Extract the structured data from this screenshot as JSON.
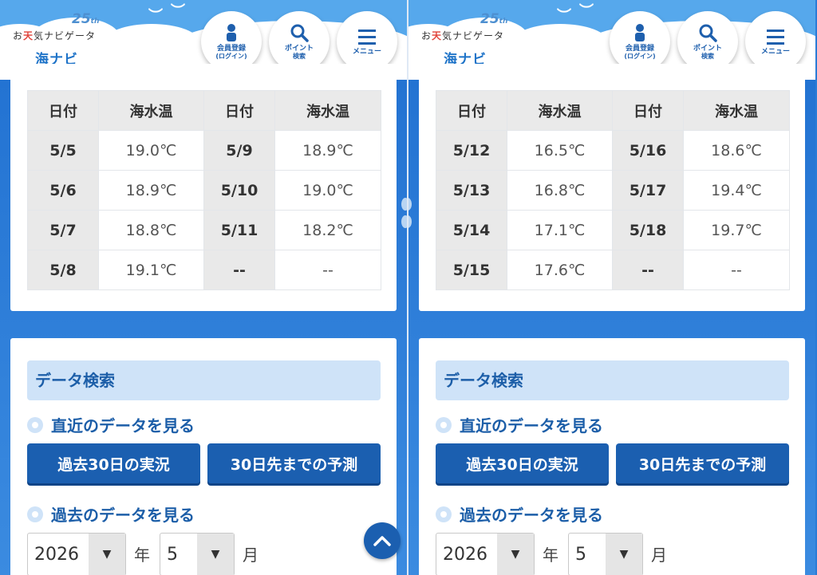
{
  "header": {
    "logo_prefix": "お",
    "logo_accent": "天",
    "logo_suffix": "気ナビゲータ",
    "logo_anniversary": "25",
    "logo_anniversary_suffix": "th",
    "logo_sub": "海ナビ",
    "buttons": {
      "member": {
        "label": "会員登録",
        "sub": "(ログイン)",
        "icon": "person-icon"
      },
      "point": {
        "label": "ポイント",
        "sub": "検索",
        "icon": "search-icon"
      },
      "menu": {
        "label": "メニュー",
        "icon": "hamburger-icon"
      }
    }
  },
  "table_headers": {
    "date": "日付",
    "temp": "海水温"
  },
  "panels": [
    {
      "rows": [
        {
          "d1": "5/5",
          "t1": "19.0℃",
          "d2": "5/9",
          "t2": "18.9℃"
        },
        {
          "d1": "5/6",
          "t1": "18.9℃",
          "d2": "5/10",
          "t2": "19.0℃"
        },
        {
          "d1": "5/7",
          "t1": "18.8℃",
          "d2": "5/11",
          "t2": "18.2℃"
        },
        {
          "d1": "5/8",
          "t1": "19.1℃",
          "d2": "--",
          "t2": "--"
        }
      ]
    },
    {
      "rows": [
        {
          "d1": "5/12",
          "t1": "16.5℃",
          "d2": "5/16",
          "t2": "18.6℃"
        },
        {
          "d1": "5/13",
          "t1": "16.8℃",
          "d2": "5/17",
          "t2": "19.4℃"
        },
        {
          "d1": "5/14",
          "t1": "17.1℃",
          "d2": "5/18",
          "t2": "19.7℃"
        },
        {
          "d1": "5/15",
          "t1": "17.6℃",
          "d2": "--",
          "t2": "--"
        }
      ]
    }
  ],
  "search": {
    "title": "データ検索",
    "recent_label": "直近のデータを見る",
    "past30_button": "過去30日の実況",
    "forecast_button": "30日先までの予測",
    "past_label": "過去のデータを見る",
    "year_value": "2026",
    "year_unit": "年",
    "month_value": "5",
    "month_unit": "月"
  },
  "colors": {
    "primary": "#1b5fb0",
    "accent_light": "#cfe3f8",
    "background": "#2a7bd6"
  }
}
